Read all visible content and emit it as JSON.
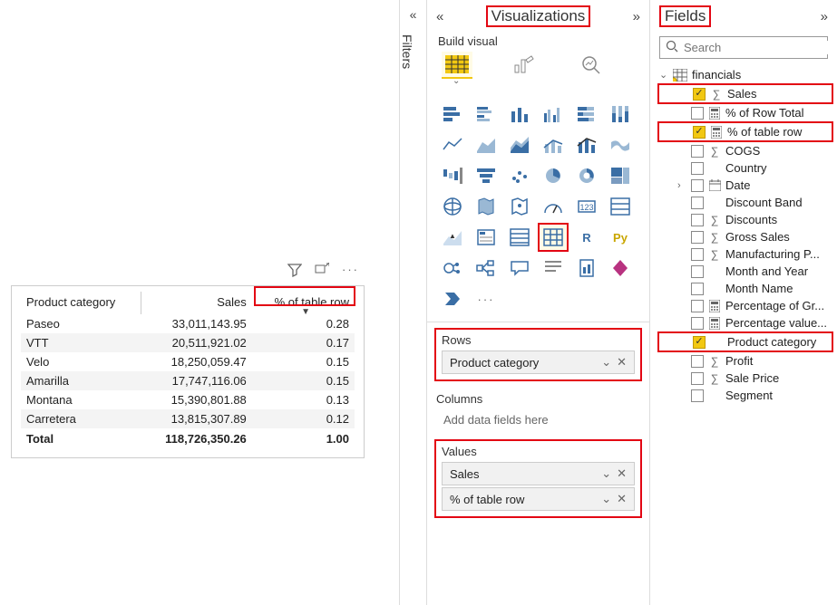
{
  "panes": {
    "filters_title": "Filters",
    "viz_title": "Visualizations",
    "fields_title": "Fields",
    "build_label": "Build visual",
    "search_placeholder": "Search",
    "ellipsis": "..."
  },
  "visual": {
    "columns": [
      "Product category",
      "Sales",
      "% of table row"
    ],
    "rows": [
      {
        "cat": "Paseo",
        "sales": "33,011,143.95",
        "pct": "0.28"
      },
      {
        "cat": "VTT",
        "sales": "20,511,921.02",
        "pct": "0.17"
      },
      {
        "cat": "Velo",
        "sales": "18,250,059.47",
        "pct": "0.15"
      },
      {
        "cat": "Amarilla",
        "sales": "17,747,116.06",
        "pct": "0.15"
      },
      {
        "cat": "Montana",
        "sales": "15,390,801.88",
        "pct": "0.13"
      },
      {
        "cat": "Carretera",
        "sales": "13,815,307.89",
        "pct": "0.12"
      }
    ],
    "total_label": "Total",
    "total_sales": "118,726,350.26",
    "total_pct": "1.00"
  },
  "wells": {
    "rows_label": "Rows",
    "rows_item": "Product category",
    "columns_label": "Columns",
    "columns_placeholder": "Add data fields here",
    "values_label": "Values",
    "values_items": [
      "Sales",
      "% of table row"
    ]
  },
  "fields": {
    "table": "financials",
    "items": [
      {
        "label": "Sales",
        "checked": true,
        "icon": "sigma",
        "red": true
      },
      {
        "label": "% of Row Total",
        "checked": false,
        "icon": "calc"
      },
      {
        "label": "% of table row",
        "checked": true,
        "icon": "calc",
        "red": true
      },
      {
        "label": "COGS",
        "checked": false,
        "icon": "sigma"
      },
      {
        "label": "Country",
        "checked": false,
        "icon": ""
      },
      {
        "label": "Date",
        "checked": false,
        "icon": "date",
        "expand": true
      },
      {
        "label": "Discount Band",
        "checked": false,
        "icon": ""
      },
      {
        "label": "Discounts",
        "checked": false,
        "icon": "sigma"
      },
      {
        "label": "Gross Sales",
        "checked": false,
        "icon": "sigma"
      },
      {
        "label": "Manufacturing P...",
        "checked": false,
        "icon": "sigma"
      },
      {
        "label": "Month and Year",
        "checked": false,
        "icon": ""
      },
      {
        "label": "Month Name",
        "checked": false,
        "icon": ""
      },
      {
        "label": "Percentage of Gr...",
        "checked": false,
        "icon": "calc"
      },
      {
        "label": "Percentage value...",
        "checked": false,
        "icon": "calc"
      },
      {
        "label": "Product category",
        "checked": true,
        "icon": "",
        "red": true
      },
      {
        "label": "Profit",
        "checked": false,
        "icon": "sigma"
      },
      {
        "label": "Sale Price",
        "checked": false,
        "icon": "sigma"
      },
      {
        "label": "Segment",
        "checked": false,
        "icon": ""
      }
    ]
  },
  "viz_icons": [
    "stacked-bar",
    "clustered-bar",
    "stacked-column",
    "clustered-column",
    "stacked-bar-100",
    "clustered-column-100",
    "line",
    "area",
    "stacked-area",
    "line-clustered",
    "line-stacked",
    "ribbon",
    "waterfall",
    "funnel",
    "scatter",
    "pie",
    "donut",
    "treemap",
    "map",
    "filled-map",
    "azure-map",
    "gauge",
    "card",
    "multi-row",
    "kpi",
    "slicer",
    "table",
    "matrix",
    "r",
    "py",
    "key-influencers",
    "decomp",
    "qna",
    "narrative",
    "paginated",
    "power-apps",
    "power-automate",
    "more"
  ],
  "r_label": "R",
  "py_label": "Py"
}
